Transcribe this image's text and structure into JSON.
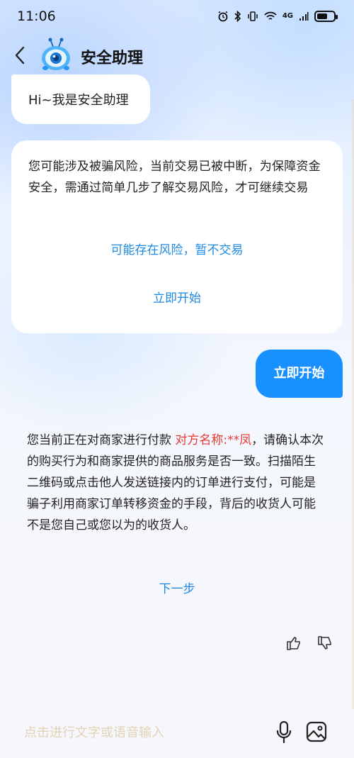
{
  "status_bar": {
    "time": "11:06",
    "network": "4G"
  },
  "header": {
    "title": "安全助理",
    "back_icon": "back-arrow-icon",
    "avatar_icon": "robot-avatar-icon"
  },
  "messages": {
    "greeting": "Hi~我是安全助理",
    "risk": {
      "text": "您可能涉及被骗风险，当前交易已被中断，为保障资金安全，需通过简单几步了解交易风险，才可继续交易",
      "option_decline": "可能存在风险，暂不交易",
      "option_start": "立即开始"
    },
    "user_reply": "立即开始",
    "payment_notice": {
      "text_before": "您当前正在对商家进行付款 ",
      "highlight": "对方名称:**凤",
      "text_after": "，请确认本次的购买行为和商家提供的商品服务是否一致。扫描陌生二维码或点击他人发送链接内的订单进行支付，可能是骗子利用商家订单转移资金的手段，背后的收货人可能不是您自己或您以为的收货人。",
      "next_label": "下一步"
    }
  },
  "input_bar": {
    "placeholder": "点击进行文字或语音输入"
  },
  "colors": {
    "accent": "#1890ff",
    "link": "#1e88e5",
    "warning": "#e53935"
  }
}
